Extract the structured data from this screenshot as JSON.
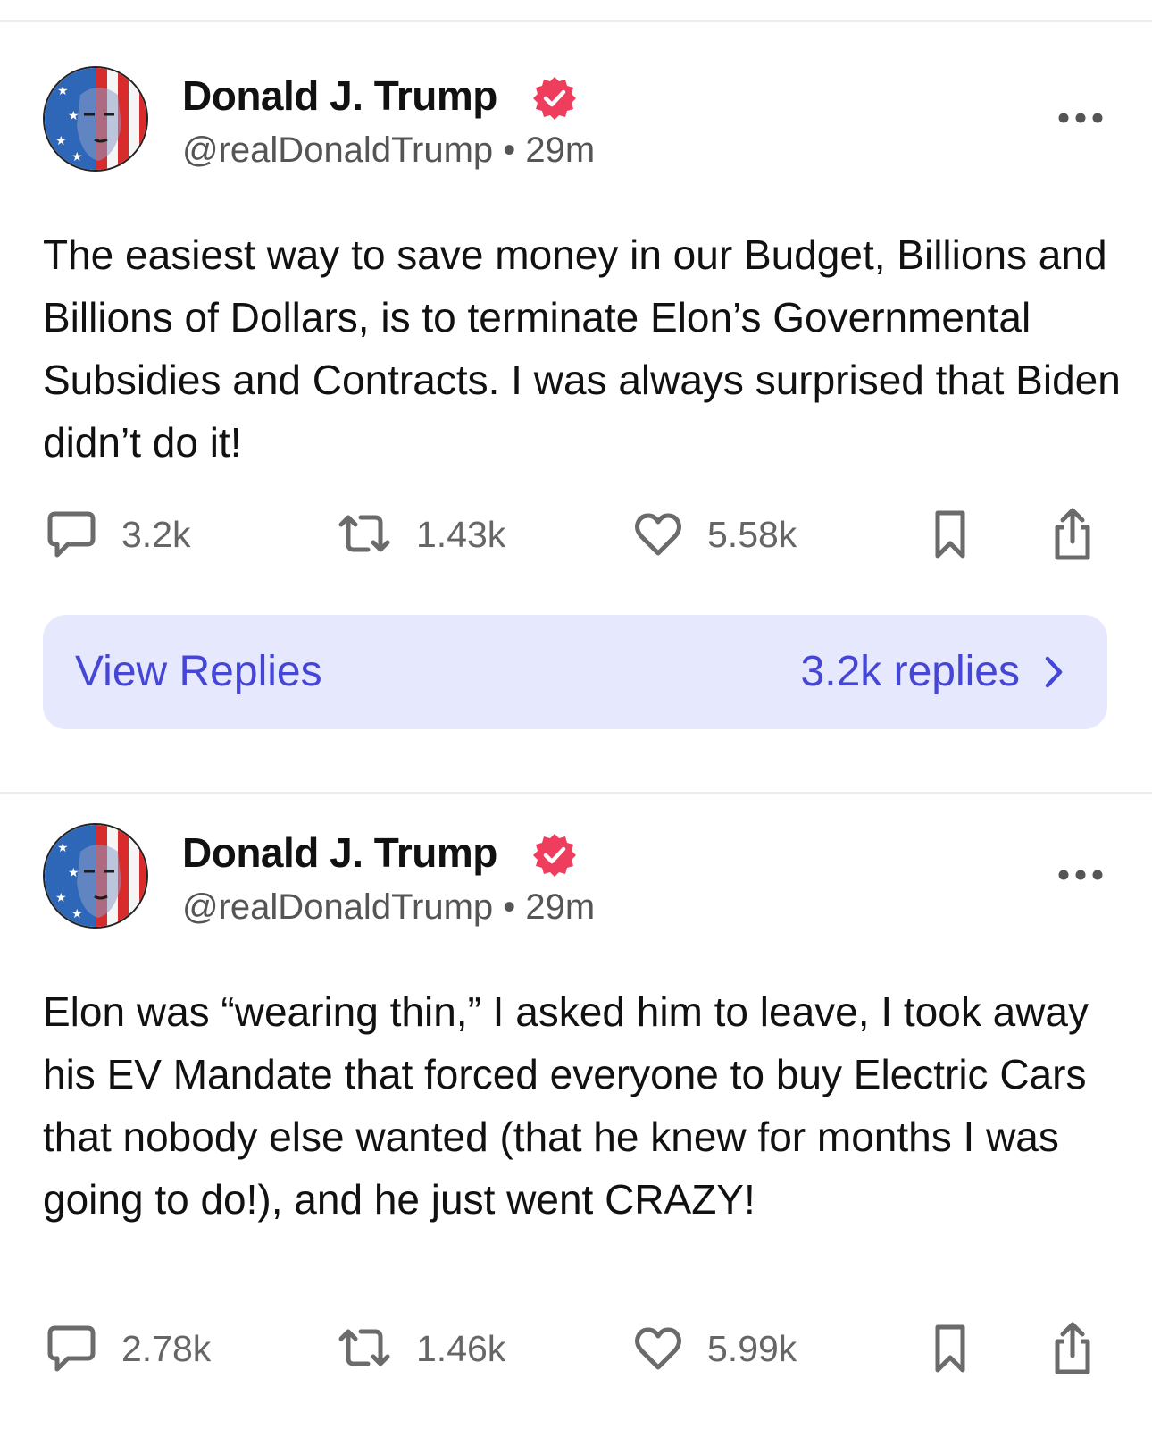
{
  "posts": [
    {
      "author_name": "Donald J. Trump",
      "handle": "@realDonaldTrump",
      "separator": "•",
      "time": "29m",
      "text": "The easiest way to save money in our Budget, Billions and Billions of Dollars, is to terminate Elon’s Governmental Subsidies and Contracts. I was always surprised that Biden didn’t do it!",
      "replies": "3.2k",
      "retruths": "1.43k",
      "likes": "5.58k",
      "view_replies_label": "View Replies",
      "view_replies_count": "3.2k replies"
    },
    {
      "author_name": "Donald J. Trump",
      "handle": "@realDonaldTrump",
      "separator": "•",
      "time": "29m",
      "text": "Elon was “wearing thin,” I asked him to leave, I took away his EV Mandate that forced everyone to buy Electric Cars that nobody else wanted (that he knew for months I was going to do!), and he just went CRAZY!",
      "replies": "2.78k",
      "retruths": "1.46k",
      "likes": "5.99k"
    }
  ],
  "colors": {
    "accent": "#4546d6",
    "view_replies_bg": "#e6e8fd",
    "verified_badge": "#ee3d5d",
    "muted_text": "#555555",
    "icon": "#6b6b6b"
  },
  "icons": [
    "verified-badge-icon",
    "more-options-icon",
    "reply-icon",
    "retruth-icon",
    "heart-icon",
    "bookmark-icon",
    "share-icon",
    "chevron-right-icon"
  ]
}
